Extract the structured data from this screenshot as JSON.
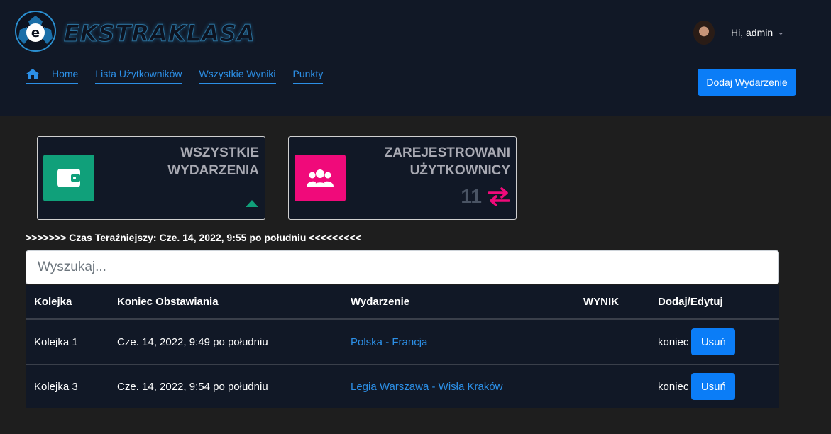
{
  "brand": {
    "name": "EKSTRAKLASA"
  },
  "user": {
    "greeting": "Hi, admin"
  },
  "nav": {
    "items": [
      {
        "label": "Home"
      },
      {
        "label": "Lista Użytkowników"
      },
      {
        "label": "Wszystkie Wyniki"
      },
      {
        "label": "Punkty"
      }
    ]
  },
  "actions": {
    "add_event": "Dodaj Wydarzenie"
  },
  "cards": [
    {
      "title_line1": "WSZYSTKIE",
      "title_line2": "WYDARZENIA",
      "color": "#10a07a"
    },
    {
      "title_line1": "ZAREJESTROWANI",
      "title_line2": "UŻYTKOWNICY",
      "count": "11",
      "color": "#f00a7a"
    }
  ],
  "clock": {
    "prefix": ">>>>>>> ",
    "text": "Czas Teraźniejszy: Cze. 14, 2022, 9:55 po południu",
    "suffix": " <<<<<<<<<"
  },
  "search": {
    "placeholder": "Wyszukaj..."
  },
  "table": {
    "headers": [
      "Kolejka",
      "Koniec Obstawiania",
      "Wydarzenie",
      "WYNIK",
      "Dodaj/Edytuj"
    ],
    "rows": [
      {
        "round": "Kolejka 1",
        "deadline": "Cze. 14, 2022, 9:49 po południu",
        "event": "Polska - Francja",
        "result": "",
        "status": "koniec",
        "delete_label": "Usuń"
      },
      {
        "round": "Kolejka 3",
        "deadline": "Cze. 14, 2022, 9:54 po południu",
        "event": "Legia Warszawa - Wisła Kraków",
        "result": "",
        "status": "koniec",
        "delete_label": "Usuń"
      }
    ]
  }
}
